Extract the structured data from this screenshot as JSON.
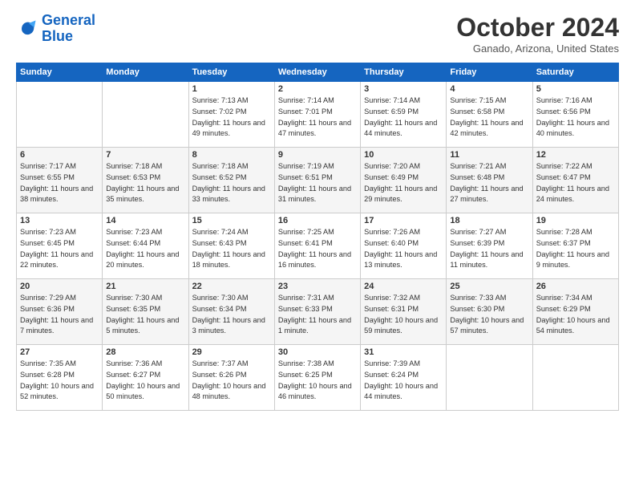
{
  "logo": {
    "line1": "General",
    "line2": "Blue"
  },
  "title": "October 2024",
  "subtitle": "Ganado, Arizona, United States",
  "days_of_week": [
    "Sunday",
    "Monday",
    "Tuesday",
    "Wednesday",
    "Thursday",
    "Friday",
    "Saturday"
  ],
  "weeks": [
    [
      {
        "day": "",
        "info": ""
      },
      {
        "day": "",
        "info": ""
      },
      {
        "day": "1",
        "info": "Sunrise: 7:13 AM\nSunset: 7:02 PM\nDaylight: 11 hours and 49 minutes."
      },
      {
        "day": "2",
        "info": "Sunrise: 7:14 AM\nSunset: 7:01 PM\nDaylight: 11 hours and 47 minutes."
      },
      {
        "day": "3",
        "info": "Sunrise: 7:14 AM\nSunset: 6:59 PM\nDaylight: 11 hours and 44 minutes."
      },
      {
        "day": "4",
        "info": "Sunrise: 7:15 AM\nSunset: 6:58 PM\nDaylight: 11 hours and 42 minutes."
      },
      {
        "day": "5",
        "info": "Sunrise: 7:16 AM\nSunset: 6:56 PM\nDaylight: 11 hours and 40 minutes."
      }
    ],
    [
      {
        "day": "6",
        "info": "Sunrise: 7:17 AM\nSunset: 6:55 PM\nDaylight: 11 hours and 38 minutes."
      },
      {
        "day": "7",
        "info": "Sunrise: 7:18 AM\nSunset: 6:53 PM\nDaylight: 11 hours and 35 minutes."
      },
      {
        "day": "8",
        "info": "Sunrise: 7:18 AM\nSunset: 6:52 PM\nDaylight: 11 hours and 33 minutes."
      },
      {
        "day": "9",
        "info": "Sunrise: 7:19 AM\nSunset: 6:51 PM\nDaylight: 11 hours and 31 minutes."
      },
      {
        "day": "10",
        "info": "Sunrise: 7:20 AM\nSunset: 6:49 PM\nDaylight: 11 hours and 29 minutes."
      },
      {
        "day": "11",
        "info": "Sunrise: 7:21 AM\nSunset: 6:48 PM\nDaylight: 11 hours and 27 minutes."
      },
      {
        "day": "12",
        "info": "Sunrise: 7:22 AM\nSunset: 6:47 PM\nDaylight: 11 hours and 24 minutes."
      }
    ],
    [
      {
        "day": "13",
        "info": "Sunrise: 7:23 AM\nSunset: 6:45 PM\nDaylight: 11 hours and 22 minutes."
      },
      {
        "day": "14",
        "info": "Sunrise: 7:23 AM\nSunset: 6:44 PM\nDaylight: 11 hours and 20 minutes."
      },
      {
        "day": "15",
        "info": "Sunrise: 7:24 AM\nSunset: 6:43 PM\nDaylight: 11 hours and 18 minutes."
      },
      {
        "day": "16",
        "info": "Sunrise: 7:25 AM\nSunset: 6:41 PM\nDaylight: 11 hours and 16 minutes."
      },
      {
        "day": "17",
        "info": "Sunrise: 7:26 AM\nSunset: 6:40 PM\nDaylight: 11 hours and 13 minutes."
      },
      {
        "day": "18",
        "info": "Sunrise: 7:27 AM\nSunset: 6:39 PM\nDaylight: 11 hours and 11 minutes."
      },
      {
        "day": "19",
        "info": "Sunrise: 7:28 AM\nSunset: 6:37 PM\nDaylight: 11 hours and 9 minutes."
      }
    ],
    [
      {
        "day": "20",
        "info": "Sunrise: 7:29 AM\nSunset: 6:36 PM\nDaylight: 11 hours and 7 minutes."
      },
      {
        "day": "21",
        "info": "Sunrise: 7:30 AM\nSunset: 6:35 PM\nDaylight: 11 hours and 5 minutes."
      },
      {
        "day": "22",
        "info": "Sunrise: 7:30 AM\nSunset: 6:34 PM\nDaylight: 11 hours and 3 minutes."
      },
      {
        "day": "23",
        "info": "Sunrise: 7:31 AM\nSunset: 6:33 PM\nDaylight: 11 hours and 1 minute."
      },
      {
        "day": "24",
        "info": "Sunrise: 7:32 AM\nSunset: 6:31 PM\nDaylight: 10 hours and 59 minutes."
      },
      {
        "day": "25",
        "info": "Sunrise: 7:33 AM\nSunset: 6:30 PM\nDaylight: 10 hours and 57 minutes."
      },
      {
        "day": "26",
        "info": "Sunrise: 7:34 AM\nSunset: 6:29 PM\nDaylight: 10 hours and 54 minutes."
      }
    ],
    [
      {
        "day": "27",
        "info": "Sunrise: 7:35 AM\nSunset: 6:28 PM\nDaylight: 10 hours and 52 minutes."
      },
      {
        "day": "28",
        "info": "Sunrise: 7:36 AM\nSunset: 6:27 PM\nDaylight: 10 hours and 50 minutes."
      },
      {
        "day": "29",
        "info": "Sunrise: 7:37 AM\nSunset: 6:26 PM\nDaylight: 10 hours and 48 minutes."
      },
      {
        "day": "30",
        "info": "Sunrise: 7:38 AM\nSunset: 6:25 PM\nDaylight: 10 hours and 46 minutes."
      },
      {
        "day": "31",
        "info": "Sunrise: 7:39 AM\nSunset: 6:24 PM\nDaylight: 10 hours and 44 minutes."
      },
      {
        "day": "",
        "info": ""
      },
      {
        "day": "",
        "info": ""
      }
    ]
  ]
}
